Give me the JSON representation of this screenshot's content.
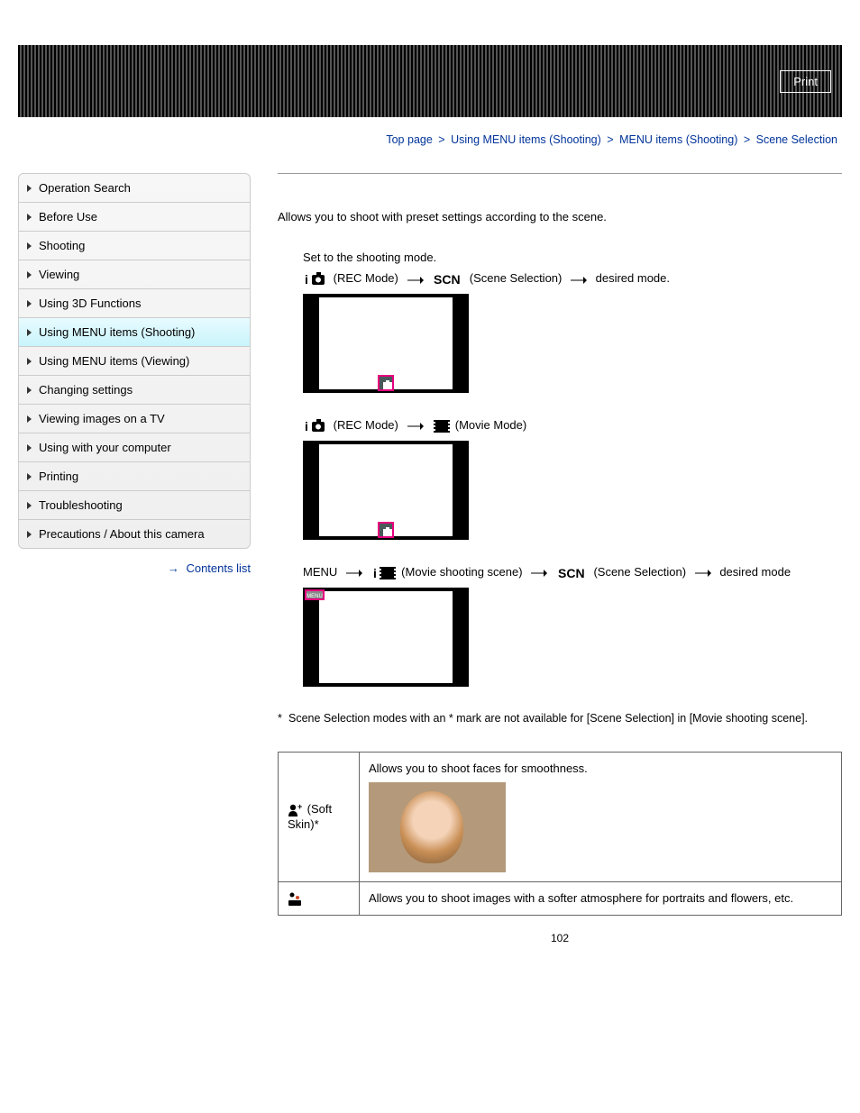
{
  "header": {
    "print_label": "Print"
  },
  "breadcrumbs": {
    "items": [
      "Top page",
      "Using MENU items (Shooting)",
      "MENU items (Shooting)",
      "Scene Selection"
    ]
  },
  "sidebar": {
    "items": [
      {
        "label": "Operation Search"
      },
      {
        "label": "Before Use"
      },
      {
        "label": "Shooting"
      },
      {
        "label": "Viewing"
      },
      {
        "label": "Using 3D Functions"
      },
      {
        "label": "Using MENU items (Shooting)",
        "active": true
      },
      {
        "label": "Using MENU items (Viewing)"
      },
      {
        "label": "Changing settings"
      },
      {
        "label": "Viewing images on a TV"
      },
      {
        "label": "Using with your computer"
      },
      {
        "label": "Printing"
      },
      {
        "label": "Troubleshooting"
      },
      {
        "label": "Precautions / About this camera"
      }
    ],
    "contents_list_label": "Contents list"
  },
  "main": {
    "intro": "Allows you to shoot with preset settings according to the scene.",
    "steps": {
      "set_mode": "Set to the shooting mode.",
      "rec_mode": "(REC Mode)",
      "scene_selection": "(Scene Selection)",
      "desired_mode": "desired mode.",
      "movie_mode": "(Movie Mode)",
      "menu_label": "MENU",
      "movie_shooting_scene": "(Movie shooting scene)",
      "desired_mode2": "desired mode",
      "menu_badge": "MENU"
    },
    "note": "Scene Selection modes with an * mark are not available for [Scene Selection] in [Movie shooting scene].",
    "modes": [
      {
        "name": " (Soft Skin)*",
        "desc": "Allows you to shoot faces for smoothness.",
        "hasImage": true
      },
      {
        "name": "",
        "desc": "Allows you to shoot images with a softer atmosphere for portraits and flowers, etc.",
        "hasImage": false
      }
    ],
    "page_number": "102"
  }
}
